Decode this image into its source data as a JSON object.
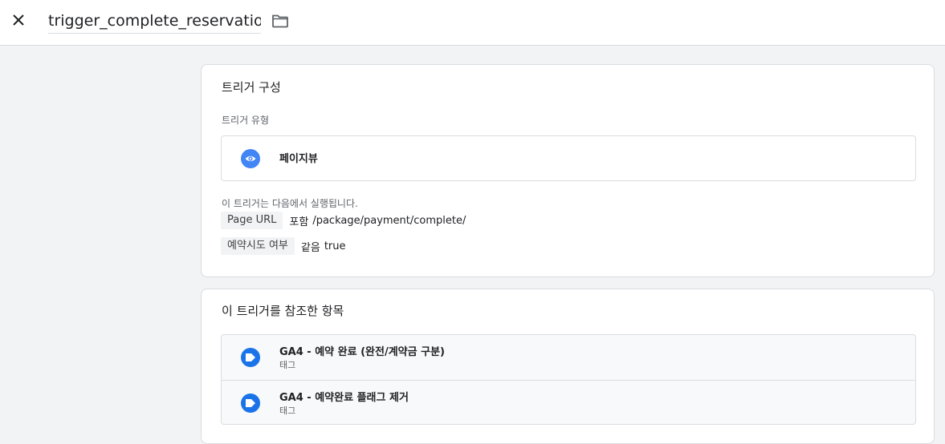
{
  "header": {
    "trigger_name": "trigger_complete_reservation",
    "close_icon": "close-icon",
    "folder_icon": "folder-icon"
  },
  "config": {
    "title": "트리거 구성",
    "type_label": "트리거 유형",
    "type_name": "페이지뷰",
    "type_icon": "eye-icon",
    "fires_on_label": "이 트리거는 다음에서 실행됩니다.",
    "conditions": [
      {
        "variable": "Page URL",
        "operator": "포함",
        "value": "/package/payment/complete/"
      },
      {
        "variable": "예약시도 여부",
        "operator": "같음",
        "value": "true"
      }
    ]
  },
  "references": {
    "title": "이 트리거를 참조한 항목",
    "items": [
      {
        "name": "GA4 - 예약 완료 (완전/계약금 구분)",
        "type": "태그",
        "icon": "tag-icon"
      },
      {
        "name": "GA4 - 예약완료 플래그 제거",
        "type": "태그",
        "icon": "tag-icon"
      }
    ]
  },
  "colors": {
    "accent": "#1a73e8",
    "eye_icon_bg": "#4285f4",
    "chip_bg": "#f1f3f4",
    "page_bg": "#f1f3f4"
  }
}
